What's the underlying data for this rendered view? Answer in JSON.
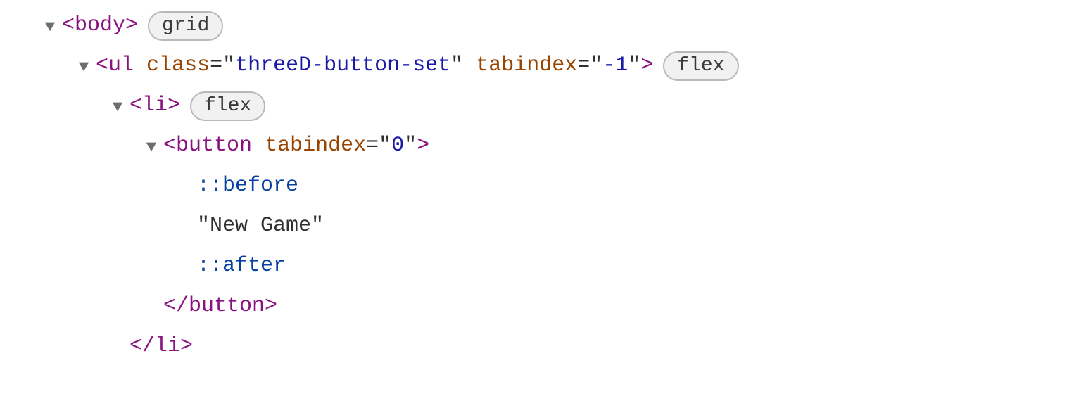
{
  "tree": {
    "line0": {
      "bodyTag": "body",
      "badge": "grid"
    },
    "line1": {
      "ulTag": "ul",
      "classAttrName": "class",
      "classAttrValue": "threeD-button-set",
      "tabindexAttrName": "tabindex",
      "tabindexAttrValue": "-1",
      "badge": "flex"
    },
    "line2": {
      "liTag": "li",
      "badge": "flex"
    },
    "line3": {
      "buttonTag": "button",
      "tabindexAttrName": "tabindex",
      "tabindexAttrValue": "0"
    },
    "line4": {
      "pseudo": "::before"
    },
    "line5": {
      "text": "\"New Game\""
    },
    "line6": {
      "pseudo": "::after"
    },
    "line7": {
      "buttonClose": "button"
    },
    "line8": {
      "liClose": "li"
    }
  }
}
